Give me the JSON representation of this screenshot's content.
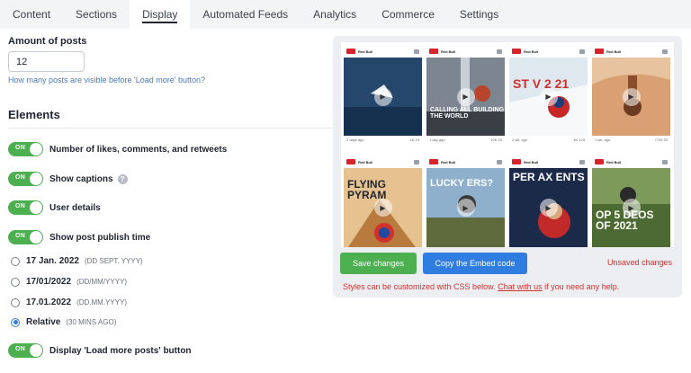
{
  "tabs": [
    {
      "label": "Content",
      "active": false
    },
    {
      "label": "Sections",
      "active": false
    },
    {
      "label": "Display",
      "active": true
    },
    {
      "label": "Automated Feeds",
      "active": false
    },
    {
      "label": "Analytics",
      "active": false
    },
    {
      "label": "Commerce",
      "active": false
    },
    {
      "label": "Settings",
      "active": false
    }
  ],
  "amount": {
    "label": "Amount of posts",
    "value": "12",
    "hint": "How many posts are visible before 'Load more' button?"
  },
  "elements": {
    "title": "Elements",
    "toggle_on": "ON",
    "likes_label": "Number of likes, comments, and retweets",
    "captions_label": "Show captions",
    "captions_help": "?",
    "user_details_label": "User details",
    "publish_time_label": "Show post publish time",
    "load_more_label": "Display 'Load more posts' button"
  },
  "date_formats": [
    {
      "label": "17 Jan. 2022",
      "format": "(DD SEPT. YYYY)",
      "selected": false
    },
    {
      "label": "17/01/2022",
      "format": "(DD/MM/YYYY)",
      "selected": false
    },
    {
      "label": "17.01.2022",
      "format": "(DD.MM.YYYY)",
      "selected": false
    },
    {
      "label": "Relative",
      "format": "(30 MINS AGO)",
      "selected": true
    }
  ],
  "preview": {
    "brand": "Red Bull",
    "posts": [
      {
        "caption": "",
        "date": "2 days ago",
        "stats": "1K  19"
      },
      {
        "caption": "CALLING ALL BUILDING THE WORLD",
        "date": "1 day ago",
        "stats": "10K  20"
      },
      {
        "caption": "ST V 2 21",
        "date": "2 wk. ago",
        "stats": "4K  103"
      },
      {
        "caption": "",
        "date": "1 wk. ago",
        "stats": "7705  33"
      },
      {
        "caption": "FLYING PYRAM",
        "date": "",
        "stats": ""
      },
      {
        "caption": "LUCKY ERS?",
        "date": "",
        "stats": ""
      },
      {
        "caption": "PER AX ENTS",
        "date": "",
        "stats": ""
      },
      {
        "caption": "OP 5 DEOS OF 2021",
        "date": "",
        "stats": ""
      }
    ],
    "colors": [
      "#24476b",
      "#6d7480",
      "#c9d7e6",
      "#c98a5a",
      "#c9874f",
      "#5b7a9a",
      "#1c2a4a",
      "#3e5a2a"
    ]
  },
  "actions": {
    "save_label": "Save changes",
    "embed_label": "Copy the Embed code",
    "unsaved_label": "Unsaved changes",
    "styles_pre": "Styles can be customized with CSS below.",
    "chat_link": "Chat with us",
    "styles_post": "if you need any help."
  }
}
